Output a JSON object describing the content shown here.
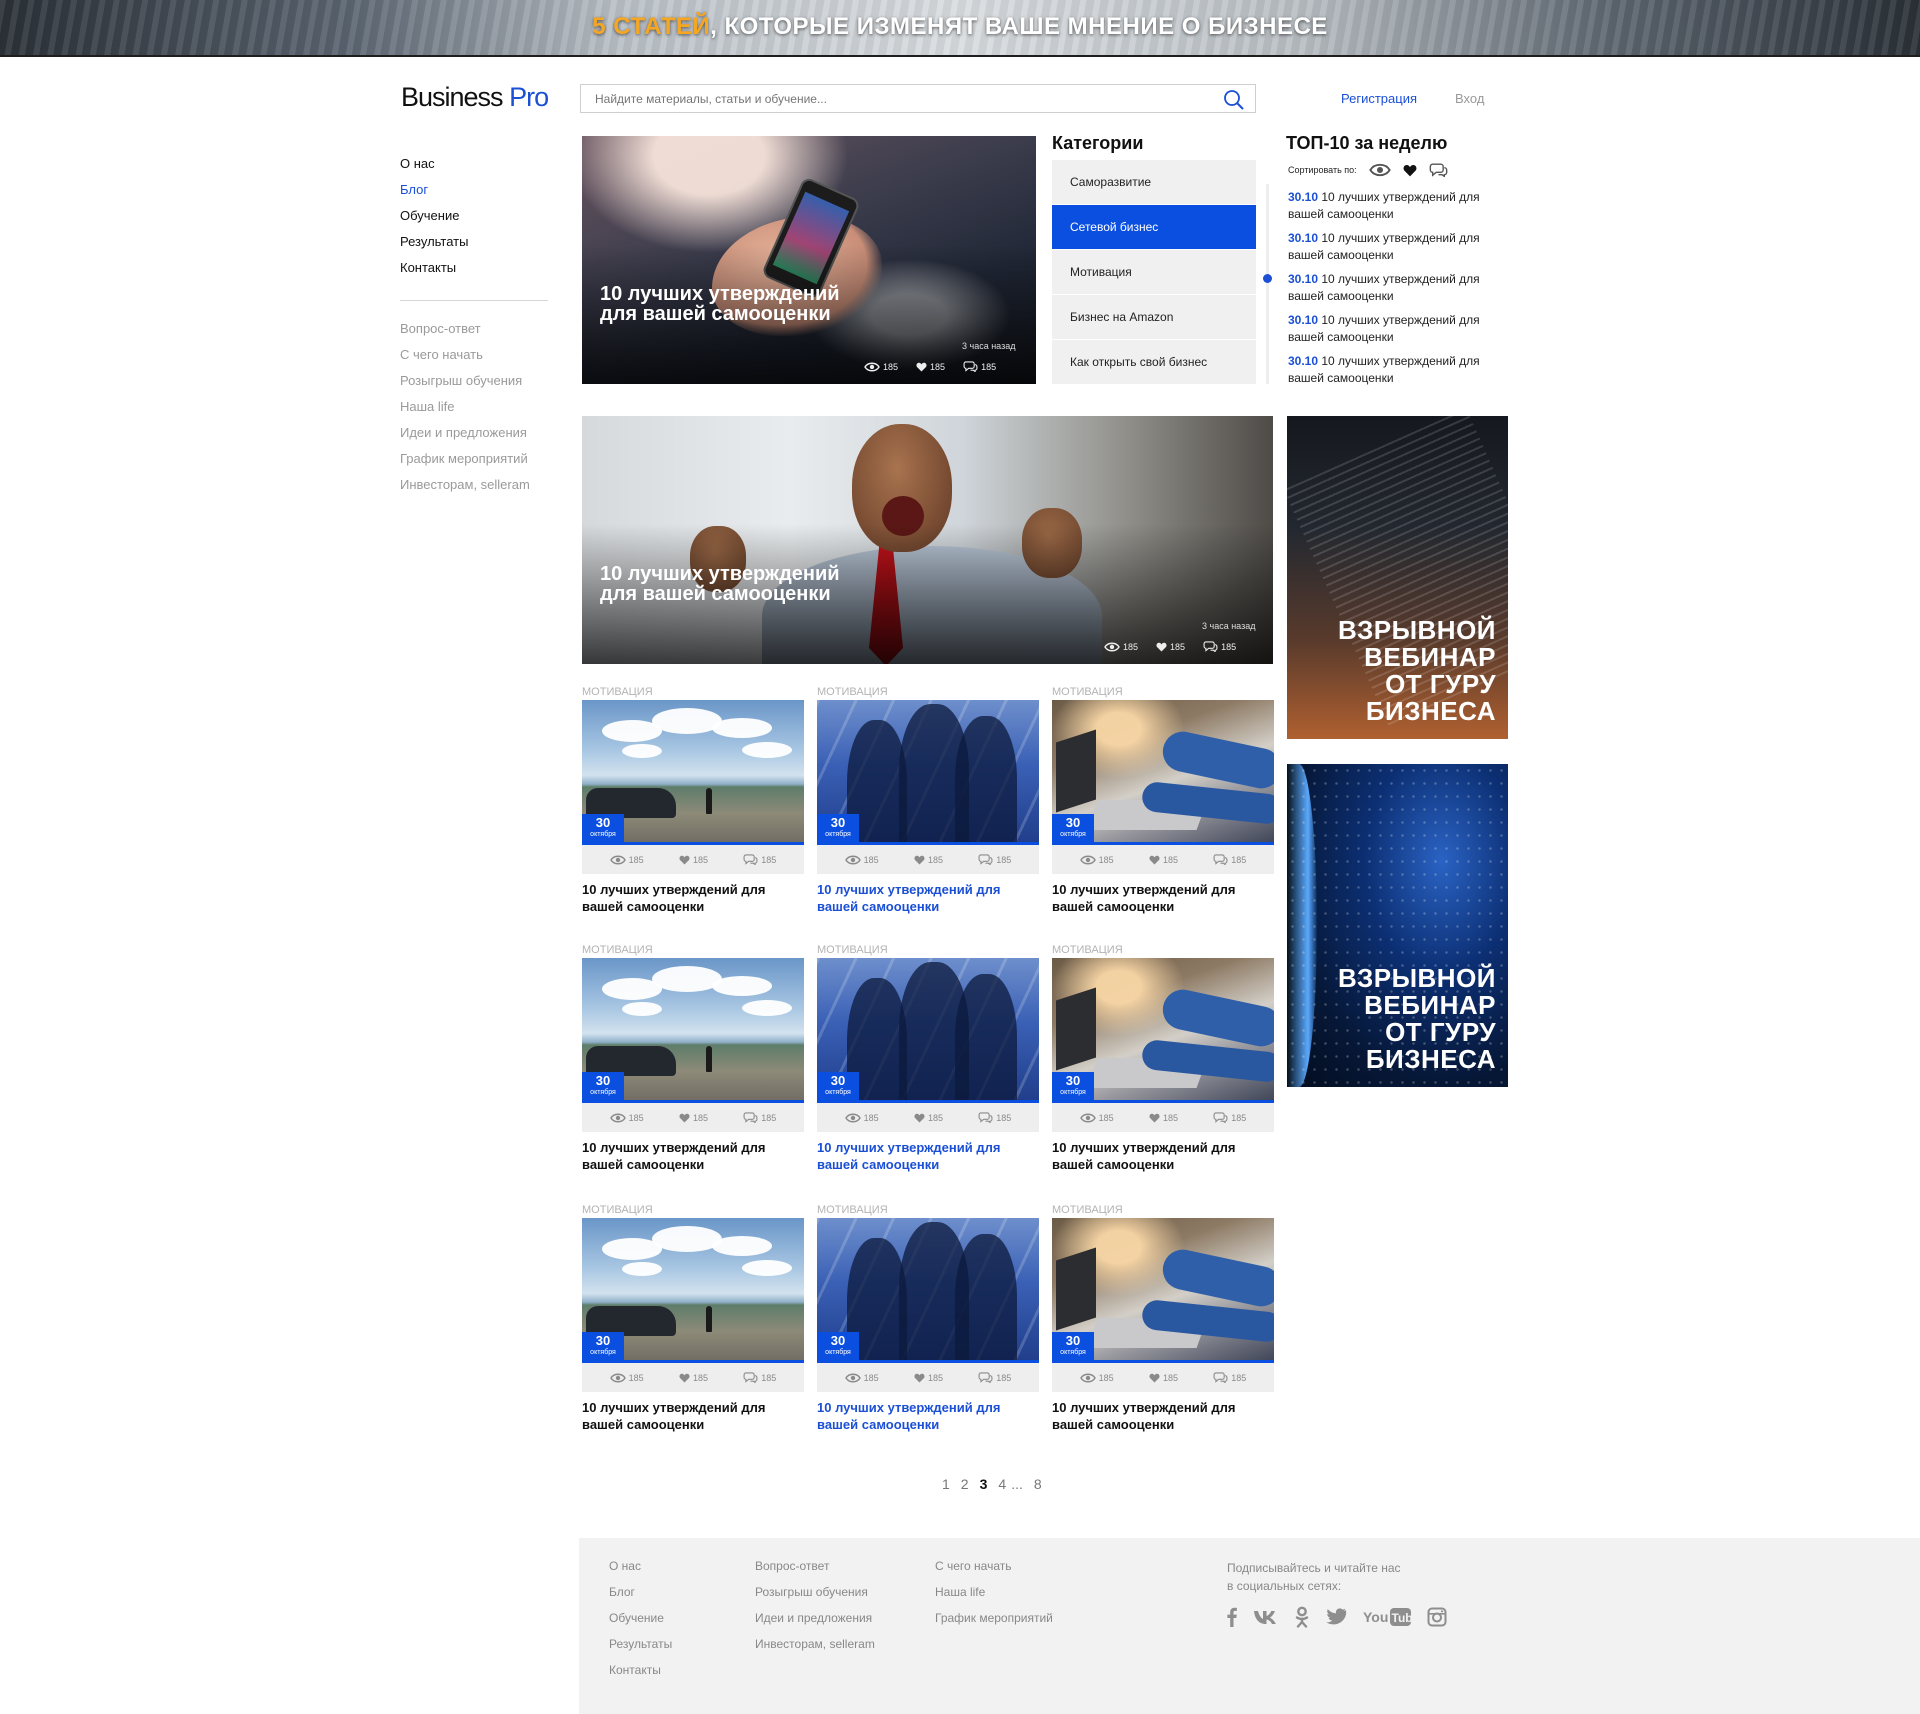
{
  "banner": {
    "accent": "5 СТАТЕЙ",
    "rest": ", КОТОРЫЕ ИЗМЕНЯТ ВАШЕ МНЕНИЕ О БИЗНЕСЕ"
  },
  "header": {
    "logo_part1": "Business",
    "logo_part2": " Pro",
    "search_placeholder": "Найдите материалы, статьи и обучение...",
    "register": "Регистрация",
    "login": "Вход"
  },
  "leftnav": {
    "main": [
      "О нас",
      "Блог",
      "Обучение",
      "Результаты",
      "Контакты"
    ],
    "active_index": 1,
    "secondary": [
      "Вопрос-ответ",
      "С чего начать",
      "Розыгрыш обучения",
      "Наша life",
      "Идеи и предложения",
      "График мероприятий",
      "Инвесторам, selleram"
    ]
  },
  "hero1": {
    "title": "10 лучших утверждений для вашей самооценки",
    "time": "3 часа назад",
    "views": "185",
    "likes": "185",
    "comments": "185"
  },
  "hero2": {
    "title": "10 лучших утверждений для вашей самооценки",
    "time": "3 часа назад",
    "views": "185",
    "likes": "185",
    "comments": "185"
  },
  "categories": {
    "title": "Категории",
    "items": [
      "Саморазвитие",
      "Сетевой бизнес",
      "Мотивация",
      "Бизнес на Amazon",
      "Как открыть свой бизнес"
    ],
    "active_index": 1
  },
  "top10": {
    "title": "ТОП-10 за неделю",
    "sort_label": "Сортировать по:",
    "items": [
      {
        "date": "30.10",
        "text": " 10 лучших утверждений для вашей самооценки"
      },
      {
        "date": "30.10",
        "text": " 10 лучших утверждений для вашей самооценки"
      },
      {
        "date": "30.10",
        "text": " 10 лучших утверждений для вашей самооценки"
      },
      {
        "date": "30.10",
        "text": " 10 лучших утверждений для вашей самооценки"
      },
      {
        "date": "30.10",
        "text": " 10 лучших утверждений для вашей самооценки"
      }
    ]
  },
  "ads": [
    {
      "line1": "ВЗРЫВНОЙ",
      "line2": "ВЕБИНАР",
      "line3": "ОТ ГУРУ",
      "line4": "БИЗНЕСА"
    },
    {
      "line1": "ВЗРЫВНОЙ",
      "line2": "ВЕБИНАР",
      "line3": "ОТ ГУРУ",
      "line4": "БИЗНЕСА"
    }
  ],
  "cards": {
    "label": "Мотивация",
    "day": "30",
    "month": "октября",
    "views": "185",
    "likes": "185",
    "comments": "185",
    "title": "10 лучших утверждений для вашей самооценки"
  },
  "pagination": {
    "p1": "1",
    "p2": "2",
    "p3": "3",
    "p4": "4",
    "ellipsis": "...",
    "last": "8"
  },
  "footer": {
    "col1": [
      "О нас",
      "Блог",
      "Обучение",
      "Результаты",
      "Контакты"
    ],
    "col2": [
      "Вопрос-ответ",
      "Розыгрыш обучения",
      "Идеи и предложения",
      "Инвесторам, selleram"
    ],
    "col3": [
      "С чего начать",
      "Наша life",
      "График мероприятий"
    ],
    "subscribe_line1": "Подписывайтесь и читайте нас",
    "subscribe_line2": "в социальных сетях:",
    "socials": [
      "facebook-icon",
      "vk-icon",
      "odnoklassniki-icon",
      "twitter-icon",
      "youtube-icon",
      "instagram-icon"
    ],
    "youtube_text": "YouTube"
  },
  "colors": {
    "accent": "#0b4fe0",
    "link": "#1a4fd6",
    "banner_accent": "#f5a623",
    "muted": "#9a9a9a"
  }
}
